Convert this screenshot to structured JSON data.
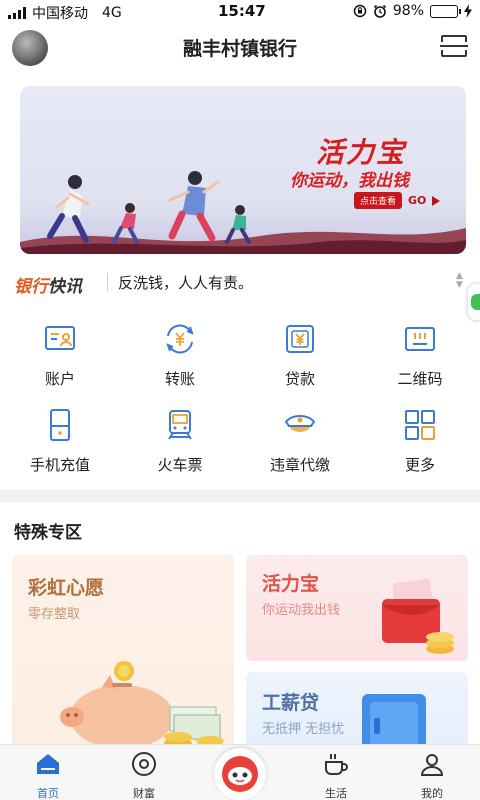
{
  "status_bar": {
    "carrier": "中国移动",
    "network": "4G",
    "time": "15:47",
    "battery": "98%",
    "battery_level": 0.98
  },
  "header": {
    "title": "融丰村镇银行"
  },
  "banner": {
    "title": "活力宝",
    "subtitle": "你运动，我出钱",
    "cta_pill": "点击查看",
    "cta_go": "GO"
  },
  "news": {
    "tag_part1": "银行",
    "tag_part2": "快讯",
    "text": "反洗钱，人人有责。"
  },
  "functions": [
    {
      "label": "账户",
      "icon": "account-card-icon"
    },
    {
      "label": "转账",
      "icon": "transfer-yen-icon"
    },
    {
      "label": "贷款",
      "icon": "loan-yen-icon"
    },
    {
      "label": "二维码",
      "icon": "qr-code-icon"
    },
    {
      "label": "手机充值",
      "icon": "phone-topup-icon"
    },
    {
      "label": "火车票",
      "icon": "train-icon"
    },
    {
      "label": "违章代缴",
      "icon": "police-cap-icon"
    },
    {
      "label": "更多",
      "icon": "more-grid-icon"
    }
  ],
  "special": {
    "title": "特殊专区",
    "cards": [
      {
        "title": "彩虹心愿",
        "subtitle": "零存整取"
      },
      {
        "title": "活力宝",
        "subtitle": "你运动我出钱"
      },
      {
        "title": "工薪贷",
        "subtitle": "无抵押 无担忧"
      }
    ]
  },
  "tabbar": {
    "items": [
      {
        "label": "首页",
        "active": true
      },
      {
        "label": "财富",
        "active": false
      },
      {
        "label": "",
        "active": false
      },
      {
        "label": "生活",
        "active": false
      },
      {
        "label": "我的",
        "active": false
      }
    ]
  },
  "colors": {
    "accent_blue": "#2a6fd6",
    "icon_blue": "#3a7bd5",
    "icon_orange": "#f0a033",
    "banner_red": "#d81e1e",
    "news_orange": "#e25a1d"
  }
}
